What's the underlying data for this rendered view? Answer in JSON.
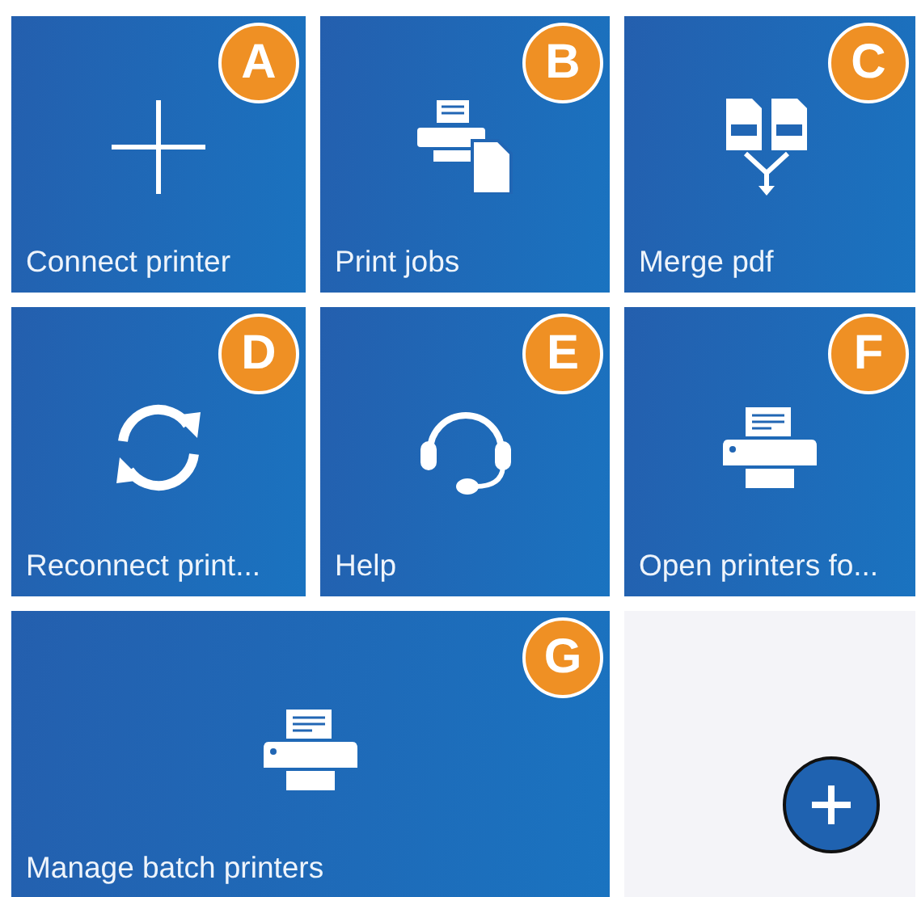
{
  "tiles": [
    {
      "label": "Connect printer",
      "kind": "plus",
      "badge": "A",
      "wide": false
    },
    {
      "label": "Print jobs",
      "kind": "print-jobs",
      "badge": "B",
      "wide": false
    },
    {
      "label": "Merge pdf",
      "kind": "merge-pdf",
      "badge": "C",
      "wide": false
    },
    {
      "label": "Reconnect print...",
      "kind": "sync",
      "badge": "D",
      "wide": false
    },
    {
      "label": "Help",
      "kind": "headset",
      "badge": "E",
      "wide": false
    },
    {
      "label": "Open printers fo...",
      "kind": "printer",
      "badge": "F",
      "wide": false
    },
    {
      "label": "Manage batch printers",
      "kind": "printer",
      "badge": "G",
      "wide": true
    }
  ],
  "add_button": {
    "kind": "plus"
  }
}
